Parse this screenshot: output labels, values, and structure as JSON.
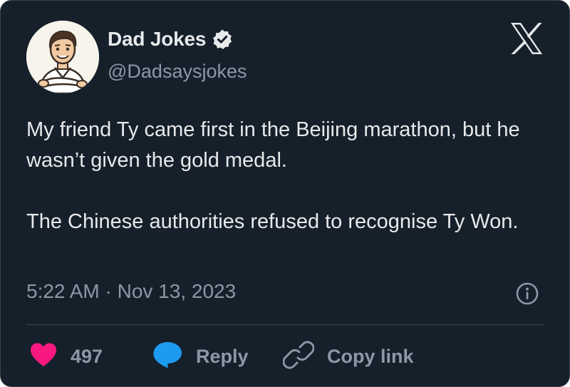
{
  "author": {
    "name": "Dad Jokes",
    "handle": "@Dadsaysjokes",
    "verified": true
  },
  "icons": {
    "avatar": "cartoon-dad-avatar",
    "verified": "verified-badge-icon",
    "brand": "x-logo-icon",
    "info": "info-icon",
    "like": "heart-icon",
    "reply": "speech-bubble-icon",
    "copy": "link-icon"
  },
  "tweet": {
    "paragraphs": [
      "My friend Ty came first in the Beijing marathon, but he wasn’t given the gold medal.",
      "The Chinese authorities refused to recognise Ty Won."
    ],
    "timestamp": "5:22 AM · Nov 13, 2023"
  },
  "actions": {
    "like_count": "497",
    "reply_label": "Reply",
    "copy_label": "Copy link"
  },
  "colors": {
    "background": "#15202b",
    "border": "#38444d",
    "text_primary": "#e7e9ea",
    "text_secondary": "#8b98a5",
    "like": "#f91880",
    "reply": "#1d9bf0"
  }
}
